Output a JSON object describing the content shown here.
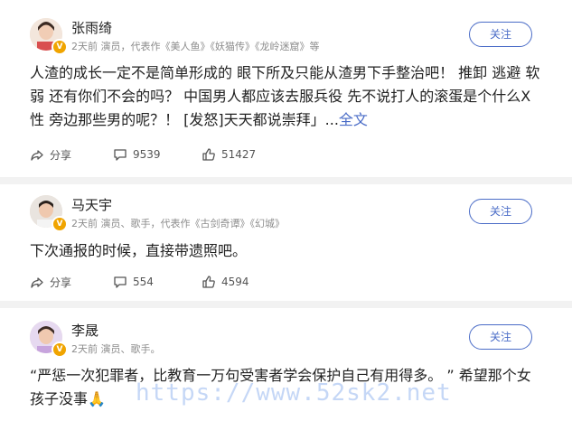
{
  "posts": [
    {
      "name": "张雨绮",
      "meta": "2天前 演员，代表作《美人鱼》《妖猫传》《龙岭迷窟》等",
      "follow_label": "关注",
      "body": "人渣的成长一定不是简单形成的 眼下所及只能从渣男下手整治吧！ 推卸 逃避 软弱 还有你们不会的吗？ 中国男人都应该去服兵役 先不说打人的滚蛋是个什么X性 旁边那些男的呢？！ [发怒]天天都说崇拜」...",
      "fulltext_label": "全文",
      "share_label": "分享",
      "comments": "9539",
      "likes": "51427"
    },
    {
      "name": "马天宇",
      "meta": "2天前 演员、歌手，代表作《古剑奇谭》《幻城》",
      "follow_label": "关注",
      "body": "下次通报的时候，直接带遗照吧。",
      "share_label": "分享",
      "comments": "554",
      "likes": "4594"
    },
    {
      "name": "李晟",
      "meta": "2天前 演员、歌手。",
      "follow_label": "关注",
      "body": "“严惩一次犯罪者，比教育一万句受害者学会保护自己有用得多。 ” 希望那个女孩子没事🙏"
    }
  ],
  "watermark": "https://www.52sk2.net",
  "icons": {
    "share": "share-icon",
    "comment": "comment-icon",
    "like": "thumbs-up-icon",
    "verified": "verified-badge-icon"
  },
  "colors": {
    "accent": "#4a6cc7",
    "verified": "#f0a400",
    "meta": "#8c8c8c"
  }
}
